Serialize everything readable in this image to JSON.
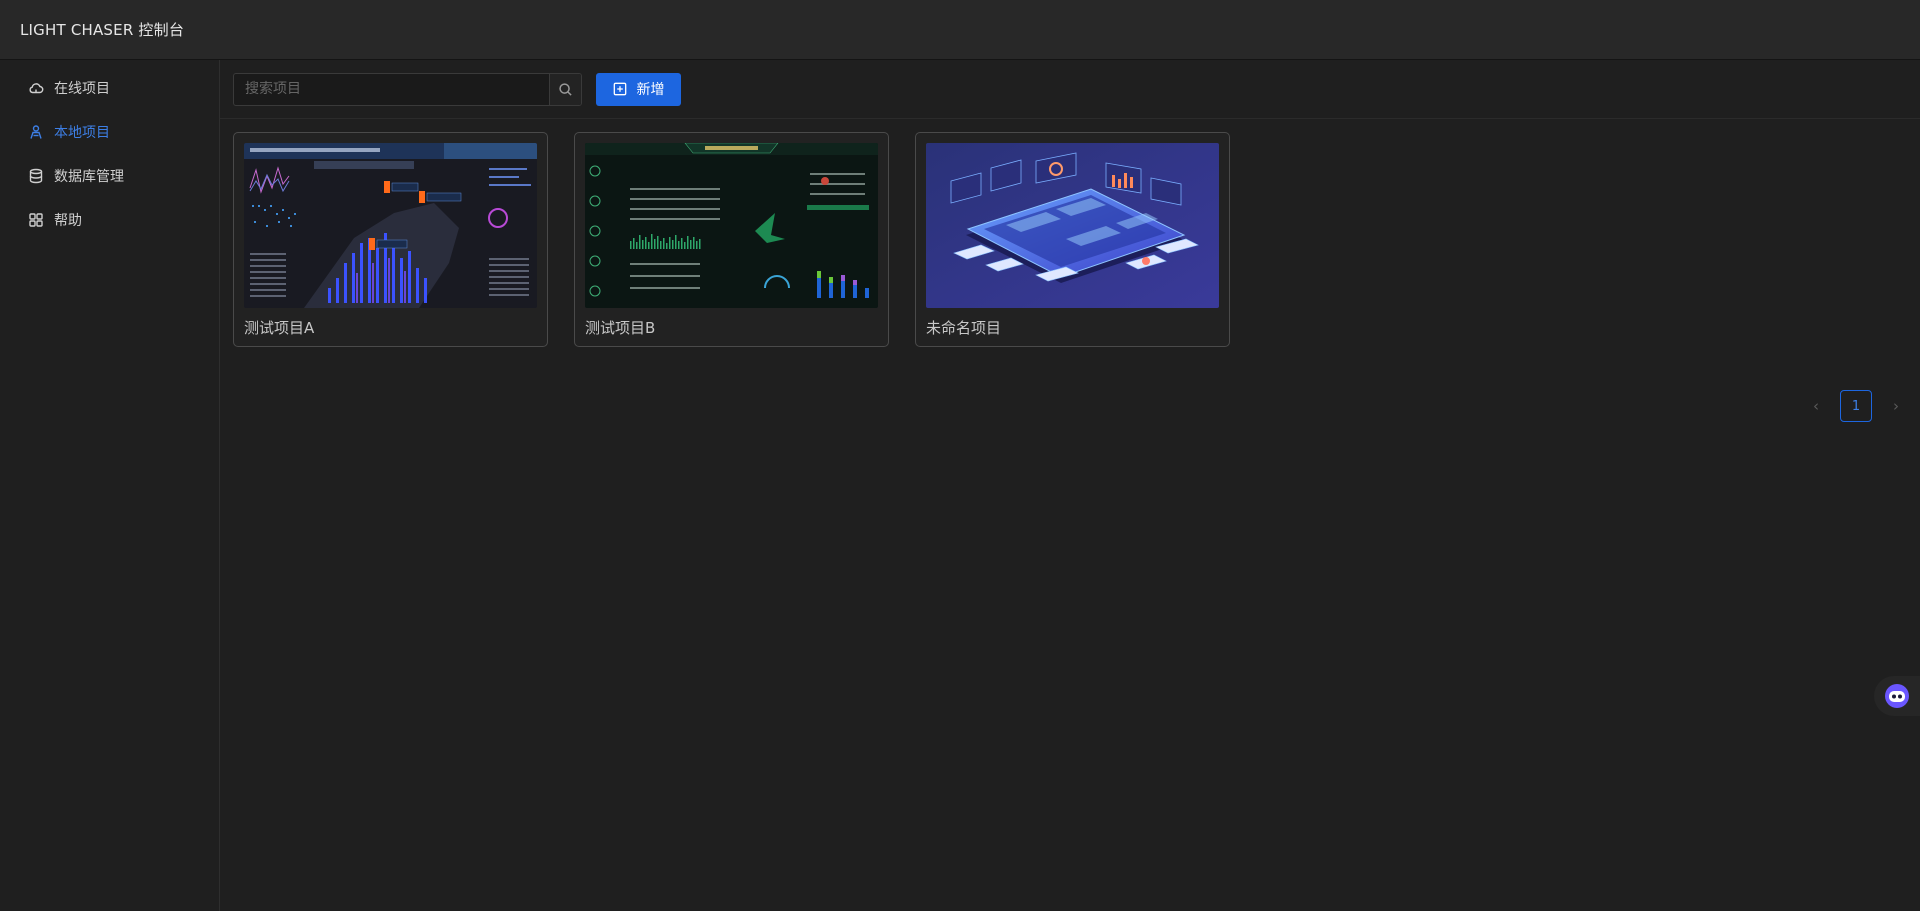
{
  "app": {
    "title": "LIGHT CHASER 控制台"
  },
  "sidebar": {
    "items": [
      {
        "label": "在线项目",
        "icon": "cloud-icon",
        "active": false
      },
      {
        "label": "本地项目",
        "icon": "user-icon",
        "active": true
      },
      {
        "label": "数据库管理",
        "icon": "database-icon",
        "active": false
      },
      {
        "label": "帮助",
        "icon": "grid-icon",
        "active": false
      }
    ]
  },
  "toolbar": {
    "search_placeholder": "搜索项目",
    "search_value": "",
    "add_label": "新增"
  },
  "projects": [
    {
      "name": "测试项目A",
      "thumbnail": "map-dashboard"
    },
    {
      "name": "测试项目B",
      "thumbnail": "green-dashboard"
    },
    {
      "name": "未命名项目",
      "thumbnail": "isometric-tablet"
    }
  ],
  "pagination": {
    "current": "1"
  },
  "colors": {
    "accent": "#1d66e0",
    "active_text": "#3d7fe6",
    "background": "#1f1f1f",
    "header": "#282828"
  }
}
